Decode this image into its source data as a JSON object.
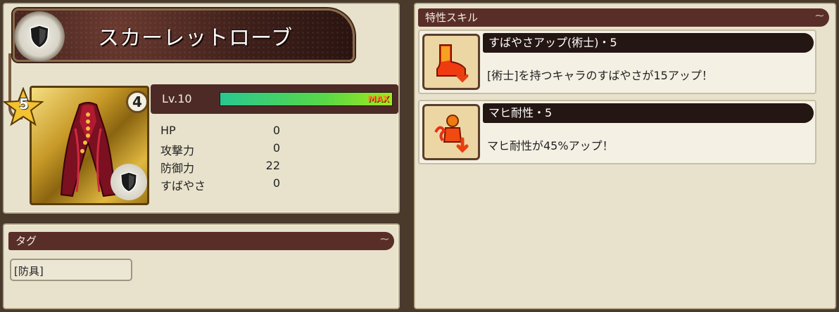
{
  "item": {
    "name": "スカーレットローブ",
    "level_badge": "4",
    "rarity": "5",
    "level_label": "Lv.10",
    "level_progress": 1.0,
    "gauge_max_label": "MAX",
    "stats": [
      {
        "label": "HP",
        "value": "0"
      },
      {
        "label": "攻撃力",
        "value": "0"
      },
      {
        "label": "防御力",
        "value": "22"
      },
      {
        "label": "すばやさ",
        "value": "0"
      }
    ]
  },
  "tags": {
    "header": "タグ",
    "items": [
      "[防具]"
    ]
  },
  "skills": {
    "header": "特性スキル",
    "items": [
      {
        "name": "すばやさアップ(術士)・5",
        "description": "[術士]を持つキャラのすばやさが15アップ！",
        "icon": "boot-speed-icon"
      },
      {
        "name": "マヒ耐性・5",
        "description": "マヒ耐性が45%アップ！",
        "icon": "paralysis-resist-icon"
      }
    ]
  },
  "colors": {
    "header_bar": "#5a2e28",
    "panel_bg": "#e8e2cc",
    "gauge_start": "#2ac890",
    "gauge_end": "#a4e81a",
    "gauge_max_text": "#ff8a2a"
  }
}
